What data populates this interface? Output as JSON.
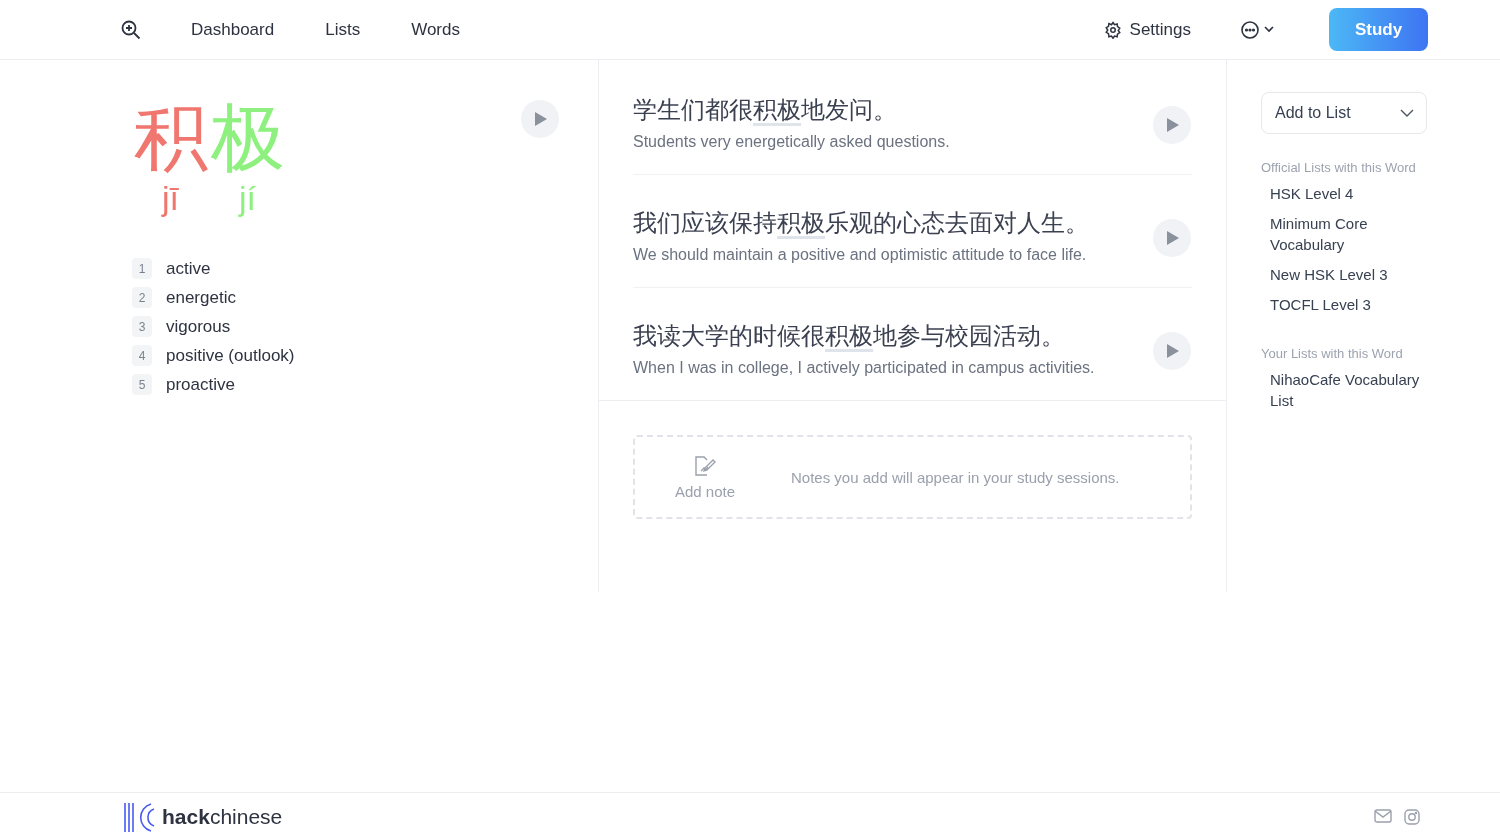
{
  "nav": {
    "links": [
      {
        "label": "Dashboard"
      },
      {
        "label": "Lists"
      },
      {
        "label": "Words"
      }
    ],
    "settings": "Settings",
    "study": "Study"
  },
  "word": {
    "characters": [
      {
        "hanzi": "积",
        "pinyin": "jī",
        "color": "#f0776f"
      },
      {
        "hanzi": "极",
        "pinyin": "jí",
        "color": "#8ef07f"
      }
    ],
    "definitions": [
      {
        "number": "1",
        "text": "active"
      },
      {
        "number": "2",
        "text": "energetic"
      },
      {
        "number": "3",
        "text": "vigorous"
      },
      {
        "number": "4",
        "text": "positive (outlook)"
      },
      {
        "number": "5",
        "text": "proactive"
      }
    ]
  },
  "sentences": [
    {
      "before": "学生们都很",
      "word": "积极",
      "after": "地发问。",
      "translation": "Students very energetically asked questions."
    },
    {
      "before": "我们应该保持",
      "word": "积极",
      "after": "乐观的心态去面对人生。",
      "translation": "We should maintain a positive and optimistic attitude to face life."
    },
    {
      "before": "我读大学的时候很",
      "word": "积极",
      "after": "地参与校园活动。",
      "translation": "When I was in college, I actively participated in campus activities."
    }
  ],
  "note": {
    "button": "Add note",
    "hint": "Notes you add will appear in your study sessions."
  },
  "lists": {
    "add_button": "Add to List",
    "official_heading": "Official Lists with this Word",
    "official": [
      "HSK Level 4",
      "Minimum Core Vocabulary",
      "New HSK Level 3",
      "TOCFL Level 3"
    ],
    "yours_heading": "Your Lists with this Word",
    "yours": [
      "NihaoCafe Vocabulary List"
    ]
  },
  "footer": {
    "logo": "**hack**chinese"
  }
}
